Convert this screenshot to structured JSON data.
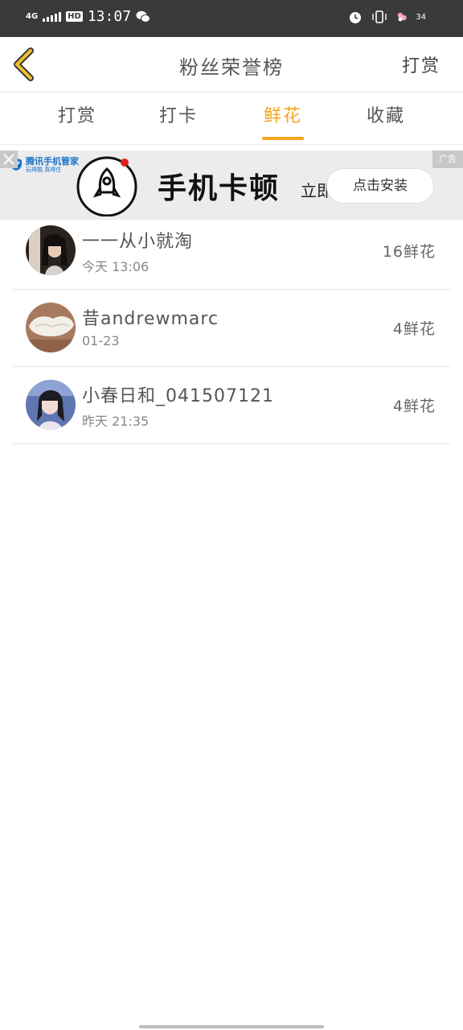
{
  "status_bar": {
    "network": "4G",
    "hd": "HD",
    "time": "13:07",
    "battery": "34"
  },
  "header": {
    "title": "粉丝荣誉榜",
    "action": "打赏"
  },
  "tabs": [
    {
      "label": "打赏",
      "active": false
    },
    {
      "label": "打卡",
      "active": false
    },
    {
      "label": "鲜花",
      "active": true
    },
    {
      "label": "收藏",
      "active": false
    }
  ],
  "ad": {
    "badge": "广告",
    "brand_name": "腾讯手机管家",
    "brand_sub": "玩得酷 真得住",
    "headline": "手机卡顿",
    "subtext": "立即",
    "install_button": "点击安装"
  },
  "fans": [
    {
      "name": "一一从小就淘",
      "time": "今天 13:06",
      "count": "16鲜花"
    },
    {
      "name": "昔andrewmarc",
      "time": "01-23",
      "count": "4鲜花"
    },
    {
      "name": "小春日和_041507121",
      "time": "昨天 21:35",
      "count": "4鲜花"
    }
  ],
  "colors": {
    "accent": "#f5a623",
    "status_bar": "#3a3a3a",
    "back_arrow": "#f2c02d"
  }
}
